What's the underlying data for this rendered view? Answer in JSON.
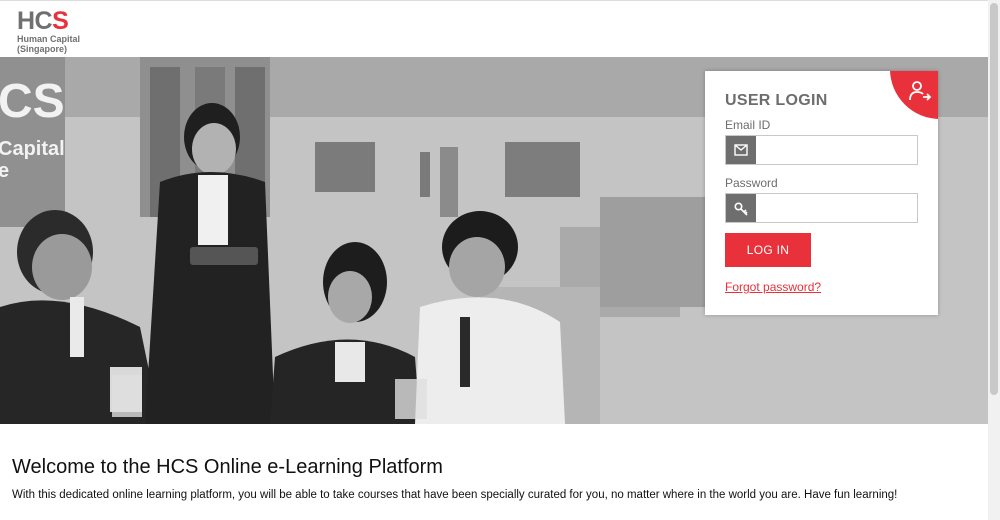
{
  "header": {
    "logo_mark_main": "HC",
    "logo_mark_accent": "S",
    "logo_line1": "Human Capital",
    "logo_line2": "(Singapore)"
  },
  "hero": {
    "image_description": "",
    "wall_logo_text": "CS",
    "wall_text_1": "Capital",
    "wall_text_2": "e"
  },
  "login": {
    "title": "USER LOGIN",
    "email_label": "Email ID",
    "email_value": "",
    "email_placeholder": "",
    "password_label": "Password",
    "password_value": "",
    "password_placeholder": "",
    "login_button": "LOG IN",
    "forgot_link": "Forgot password?",
    "icons": {
      "corner": "user-login-icon",
      "email": "envelope-icon",
      "password": "key-icon"
    }
  },
  "welcome": {
    "title": "Welcome to the HCS Online e-Learning Platform",
    "text": "With this dedicated online learning platform, you will be able to take courses that have been specially curated for you, no matter where in the world you are. Have fun learning!"
  },
  "colors": {
    "accent": "#e8313a",
    "logo_gray": "#707070",
    "label_gray": "#6d6d6d"
  }
}
